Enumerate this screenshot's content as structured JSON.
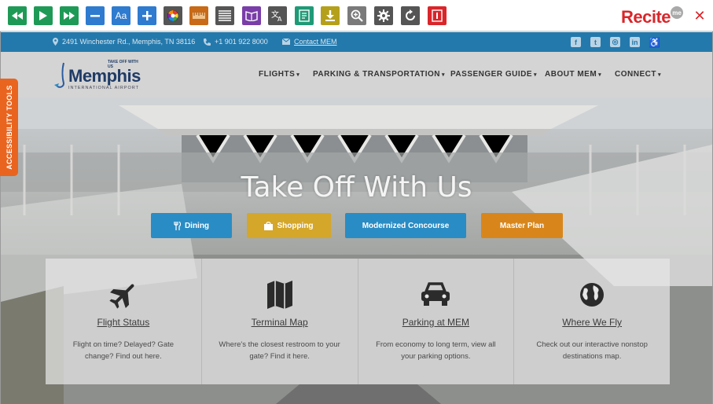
{
  "toolbar": {
    "buttons": [
      {
        "name": "rewind-button",
        "icon": "rewind-icon",
        "color": "#1f9a56"
      },
      {
        "name": "play-button",
        "icon": "play-icon",
        "color": "#1f9a56"
      },
      {
        "name": "fast-forward-button",
        "icon": "fast-forward-icon",
        "color": "#1f9a56"
      },
      {
        "name": "decrease-text-button",
        "icon": "minus-icon",
        "color": "#2e7bd0"
      },
      {
        "name": "font-button",
        "icon": "font-icon",
        "color": "#2e7bd0",
        "label": "Aa"
      },
      {
        "name": "increase-text-button",
        "icon": "plus-icon",
        "color": "#2e7bd0"
      },
      {
        "name": "color-wheel-button",
        "icon": "color-wheel-icon",
        "color": "#555555"
      },
      {
        "name": "ruler-button",
        "icon": "ruler-icon",
        "color": "#c86a17"
      },
      {
        "name": "margins-button",
        "icon": "text-lines-icon",
        "color": "#555555"
      },
      {
        "name": "dictionary-button",
        "icon": "book-icon",
        "color": "#7a3ea8"
      },
      {
        "name": "translate-button",
        "icon": "translate-icon",
        "color": "#555555"
      },
      {
        "name": "reader-button",
        "icon": "document-icon",
        "color": "#1f9a76"
      },
      {
        "name": "download-button",
        "icon": "download-icon",
        "color": "#b5a01c"
      },
      {
        "name": "magnifier-button",
        "icon": "zoom-in-icon",
        "color": "#7a7a7a"
      },
      {
        "name": "settings-button",
        "icon": "gear-icon",
        "color": "#555555"
      },
      {
        "name": "reset-button",
        "icon": "refresh-icon",
        "color": "#555555"
      },
      {
        "name": "info-button",
        "icon": "exit-icon",
        "color": "#d9262b"
      }
    ],
    "logo": "Recite",
    "logo_badge": "me",
    "close_label": "✕"
  },
  "infobar": {
    "address": "2491 Winchester Rd., Memphis, TN 38116",
    "phone": "+1 901 922 8000",
    "contact": "Contact MEM",
    "social": [
      {
        "name": "facebook-icon",
        "glyph": "f"
      },
      {
        "name": "twitter-icon",
        "glyph": "t"
      },
      {
        "name": "instagram-icon",
        "glyph": "◎"
      },
      {
        "name": "linkedin-icon",
        "glyph": "in"
      },
      {
        "name": "wheelchair-icon",
        "glyph": "♿"
      }
    ]
  },
  "header": {
    "logo_top": "TAKE OFF WITH US",
    "logo_main": "Memphis",
    "logo_sub": "INTERNATIONAL AIRPORT",
    "nav": [
      "FLIGHTS",
      "PARKING & TRANSPORTATION",
      "PASSENGER GUIDE",
      "ABOUT MEM",
      "CONNECT"
    ]
  },
  "hero": {
    "title": "Take Off With Us",
    "buttons": [
      {
        "label": "Dining",
        "color": "#2a8cc4",
        "icon": "utensils-icon"
      },
      {
        "label": "Shopping",
        "color": "#d4a62a",
        "icon": "shopping-bag-icon"
      },
      {
        "label": "Modernized Concourse",
        "color": "#2a8cc4"
      },
      {
        "label": "Master Plan",
        "color": "#d8861c"
      }
    ]
  },
  "cards": [
    {
      "title": "Flight Status",
      "desc": "Flight on time? Delayed? Gate change? Find out here.",
      "icon": "airplane-icon"
    },
    {
      "title": "Terminal Map",
      "desc": "Where's the closest restroom to your gate? Find it here.",
      "icon": "map-icon"
    },
    {
      "title": "Parking at MEM",
      "desc": "From economy to long term, view all your parking options.",
      "icon": "car-icon"
    },
    {
      "title": "Where We Fly",
      "desc": "Check out our interactive nonstop destinations map.",
      "icon": "globe-icon"
    }
  ],
  "accessibility_tab": "ACCESSIBILITY TOOLS"
}
